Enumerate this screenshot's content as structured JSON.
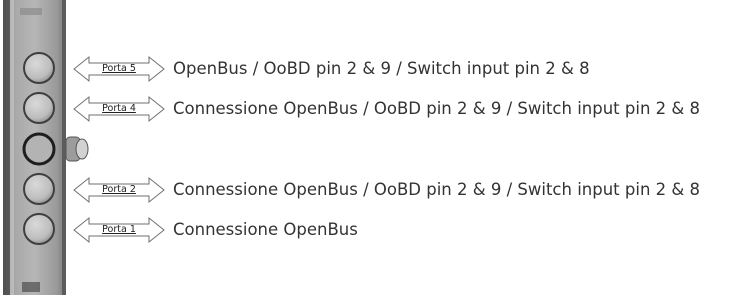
{
  "ports": [
    {
      "label": "Porta 5",
      "description": "OpenBus / OoBD pin 2 & 9 / Switch input pin 2 & 8"
    },
    {
      "label": "Porta 4",
      "description": "Connessione OpenBus / OoBD pin 2 & 9 / Switch input pin 2 & 8"
    },
    {
      "label": "Porta 2",
      "description": "Connessione OpenBus / OoBD pin 2 & 9 / Switch input pin 2 & 8"
    },
    {
      "label": "Porta 1",
      "description": "Connessione OpenBus"
    }
  ]
}
